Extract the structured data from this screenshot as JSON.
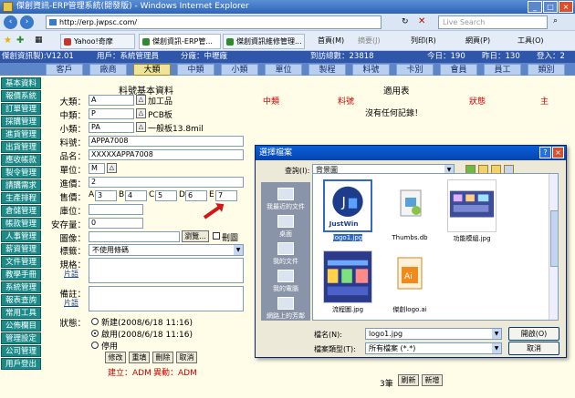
{
  "browser": {
    "title": "傑創資訊-ERP管理系統(開發版) - Windows Internet Explorer",
    "url": "http://erp.jwpsc.com/",
    "search_placeholder": "Live Search",
    "tabs": [
      "Yahoo!奇摩",
      "傑創資訊-ERP管...",
      "傑創資訊維修管理..."
    ],
    "toolbar": [
      "首頁(M)",
      "摘要(J)",
      "列印(R)",
      "網頁(P)",
      "工具(O)"
    ]
  },
  "appbar": {
    "version": "傑創資訊製):V12.01",
    "user": "用戶：系統管理員",
    "division": "分廠：中壢廠",
    "reg": "到訪總數：23818",
    "today": "今日：190",
    "yesterday": "昨日：130",
    "online": "登入：2"
  },
  "menu": [
    "客戶",
    "廠商",
    "大類",
    "中類",
    "小類",
    "單位",
    "製程",
    "料號",
    "卡別",
    "會員",
    "員工",
    "類別"
  ],
  "menu_active": "大類",
  "sidebar": [
    "基本資料",
    "報價系統",
    "訂單管理",
    "採購管理",
    "進貨管理",
    "出貨管理",
    "應收帳款",
    "製令管理",
    "請購需求",
    "生產排程",
    "倉儲管理",
    "帳款管理",
    "人事管理",
    "薪資管理",
    "文件管理",
    "教學手冊",
    "系統管理",
    "報表查詢",
    "常用工具",
    "公佈欄目",
    "管理設定",
    "公司管理",
    "用戶登出"
  ],
  "form": {
    "title": "料號基本資料",
    "fields": [
      {
        "label": "大類：",
        "value": "A",
        "extra": "加工品"
      },
      {
        "label": "中類：",
        "value": "P",
        "extra": "PCB板"
      },
      {
        "label": "小類：",
        "value": "PA",
        "extra": "一般板13.8mil"
      },
      {
        "label": "料號：",
        "value": "APPA7008"
      },
      {
        "label": "品名：",
        "value": "XXXXXAPPA7008"
      },
      {
        "label": "單位：",
        "value": "M"
      },
      {
        "label": "進價：",
        "value": "2"
      },
      {
        "label": "售價：",
        "value": ""
      },
      {
        "label": "庫位：",
        "value": ""
      },
      {
        "label": "安存量：",
        "value": "0"
      },
      {
        "label": "圖像：",
        "value": ""
      },
      {
        "label": "標籤：",
        "value": "不使用條碼"
      },
      {
        "label": "規格：",
        "value": ""
      },
      {
        "label": "備註：",
        "value": ""
      }
    ],
    "price_tiers": [
      "A",
      "B",
      "C",
      "D",
      "E"
    ],
    "price_values": [
      "3",
      "4",
      "5",
      "6",
      "7"
    ],
    "browse_label": "瀏覽...",
    "delete_image": "刪圖",
    "image_link": "片語",
    "status_label": "狀態：",
    "status_options": [
      {
        "label": "新建(2008/6/18 11:16)",
        "checked": false
      },
      {
        "label": "啟用(2008/6/18 11:16)",
        "checked": true
      },
      {
        "label": "停用",
        "checked": false
      }
    ],
    "buttons": [
      "修改",
      "重填",
      "刪除",
      "取消"
    ],
    "created": "建立：ADM",
    "modified": "異動：ADM"
  },
  "right_panel": {
    "title": "適用表",
    "columns": [
      "中類",
      "料號",
      "狀態",
      "主"
    ],
    "empty": "沒有任何記錄！",
    "pager": "3筆",
    "pager_buttons": [
      "刷新",
      "新增"
    ]
  },
  "dialog": {
    "title": "選擇檔案",
    "lookin_label": "查詢(I):",
    "lookin_value": "背景圖",
    "places": [
      "我最近的文件",
      "桌面",
      "我的文件",
      "我的電腦",
      "網路上的芳鄰"
    ],
    "files": [
      {
        "name": "logo1.jpg",
        "selected": true
      },
      {
        "name": "Thumbs.db",
        "selected": false
      },
      {
        "name": "功能模組.jpg",
        "selected": false
      },
      {
        "name": "流程圖.jpg",
        "selected": false
      },
      {
        "name": "傑創logo.ai",
        "selected": false
      }
    ],
    "filename_label": "檔名(N):",
    "filename_value": "logo1.jpg",
    "filetype_label": "檔案類型(T):",
    "filetype_value": "所有檔案 (*.*)",
    "open": "開啟(O)",
    "cancel": "取消"
  }
}
